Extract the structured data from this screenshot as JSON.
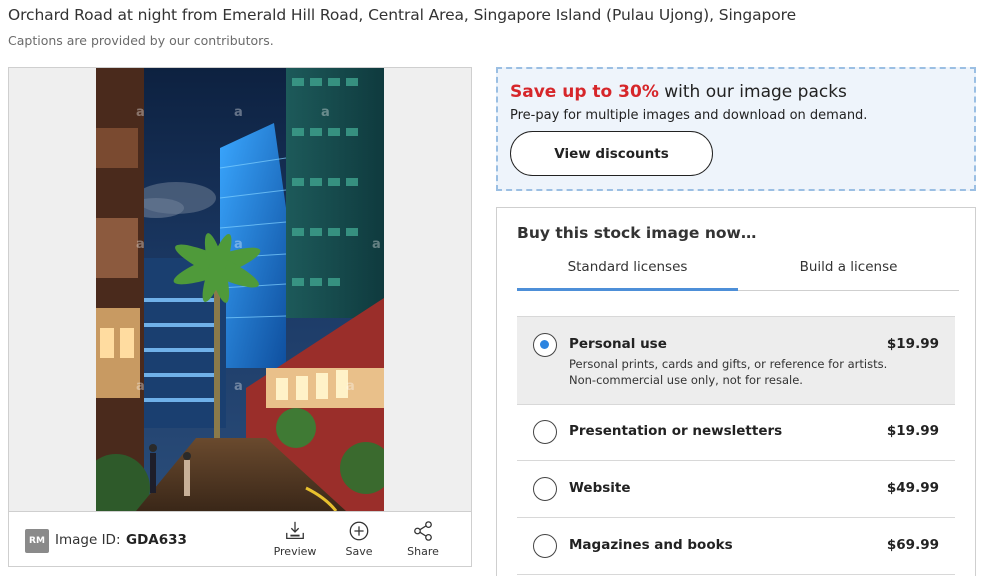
{
  "caption": {
    "title": "Orchard Road at night from Emerald Hill Road, Central Area, Singapore Island (Pulau Ujong), Singapore",
    "note": "Captions are provided by our contributors."
  },
  "image_panel": {
    "photo_alt": "Orchard Road at night from Emerald Hill Road",
    "watermark": "alamy",
    "badge": "RM",
    "image_id_label": "Image ID:",
    "image_id": "GDA633",
    "actions": [
      {
        "label": "Preview",
        "icon": "preview-download-icon"
      },
      {
        "label": "Save",
        "icon": "plus-circle-icon"
      },
      {
        "label": "Share",
        "icon": "share-icon"
      }
    ]
  },
  "promo": {
    "highlight": "Save up to 30%",
    "headline_rest": " with our image packs",
    "sub": "Pre-pay for multiple images and download on demand.",
    "button": "View discounts",
    "colors": {
      "highlight": "#d6262a",
      "background": "#eef4fb",
      "border": "#9bbfe3"
    }
  },
  "buy": {
    "title": "Buy this stock image now…",
    "tabs": [
      {
        "label": "Standard licenses",
        "active": true
      },
      {
        "label": "Build a license",
        "active": false
      }
    ],
    "licenses": [
      {
        "name": "Personal use",
        "price": "$19.99",
        "selected": true,
        "desc_line1": "Personal prints, cards and gifts, or reference for artists.",
        "desc_line2": "Non-commercial use only, not for resale."
      },
      {
        "name": "Presentation or newsletters",
        "price": "$19.99",
        "selected": false
      },
      {
        "name": "Website",
        "price": "$49.99",
        "selected": false
      },
      {
        "name": "Magazines and books",
        "price": "$69.99",
        "selected": false
      }
    ],
    "accent": "#2c84e0"
  }
}
